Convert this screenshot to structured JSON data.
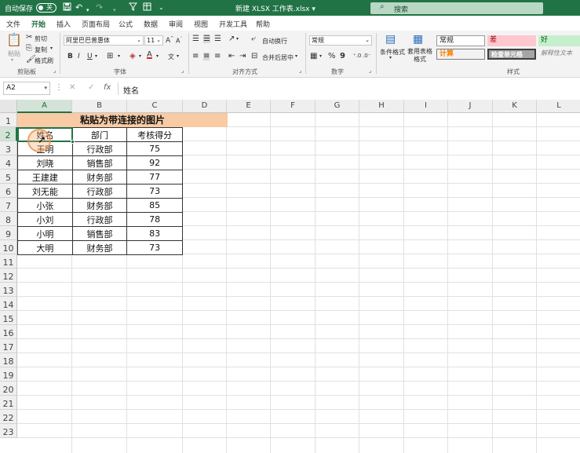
{
  "titlebar": {
    "autosave_label": "自动保存",
    "autosave_state": "关",
    "document_title": "新建 XLSX 工作表.xlsx",
    "search_placeholder": "搜索"
  },
  "tabs": [
    "文件",
    "开始",
    "插入",
    "页面布局",
    "公式",
    "数据",
    "审阅",
    "视图",
    "开发工具",
    "帮助"
  ],
  "active_tab": "开始",
  "ribbon": {
    "clipboard": {
      "paste": "粘贴",
      "cut": "剪切",
      "copy": "复制",
      "format_painter": "格式刷",
      "label": "剪贴板"
    },
    "font": {
      "font_name": "阿里巴巴普惠体",
      "font_size": "11",
      "bold": "B",
      "italic": "I",
      "underline": "U",
      "label": "字体"
    },
    "alignment": {
      "wrap": "自动换行",
      "merge": "合并后居中",
      "label": "对齐方式"
    },
    "number": {
      "format": "常规",
      "percent": "%",
      "comma": "9",
      "label": "数字"
    },
    "styles": {
      "conditional": "条件格式",
      "table_format": "套用表格格式",
      "cells": {
        "normal": "常规",
        "bad": "差",
        "good": "好",
        "calc": "计算",
        "check": "检查单元格",
        "explain": "解释性文本"
      },
      "label": "样式"
    }
  },
  "formula_bar": {
    "name_box": "A2",
    "content": "姓名",
    "fx": "fx"
  },
  "columns": [
    "A",
    "B",
    "C",
    "D",
    "E",
    "F",
    "G",
    "H",
    "I",
    "J",
    "K",
    "L"
  ],
  "rows": [
    "1",
    "2",
    "3",
    "4",
    "5",
    "6",
    "7",
    "8",
    "9",
    "10",
    "11",
    "12",
    "13",
    "14",
    "15",
    "16",
    "17",
    "18",
    "19",
    "20",
    "21",
    "22",
    "23"
  ],
  "sheet": {
    "title": "粘贴为带连接的图片",
    "header": [
      "姓名",
      "部门",
      "考核得分"
    ],
    "records": [
      [
        "王明",
        "行政部",
        "75"
      ],
      [
        "刘晓",
        "销售部",
        "92"
      ],
      [
        "王建建",
        "财务部",
        "77"
      ],
      [
        "刘无能",
        "行政部",
        "73"
      ],
      [
        "小张",
        "财务部",
        "85"
      ],
      [
        "小刘",
        "行政部",
        "78"
      ],
      [
        "小明",
        "销售部",
        "83"
      ],
      [
        "大明",
        "财务部",
        "73"
      ]
    ]
  },
  "colors": {
    "brand": "#217346",
    "title_fill": "#f8cba4",
    "bad_fill": "#ffc7ce",
    "good_fill": "#c6efce",
    "calc_fill": "#f2f2f2",
    "check_fill": "#a5a5a5"
  }
}
